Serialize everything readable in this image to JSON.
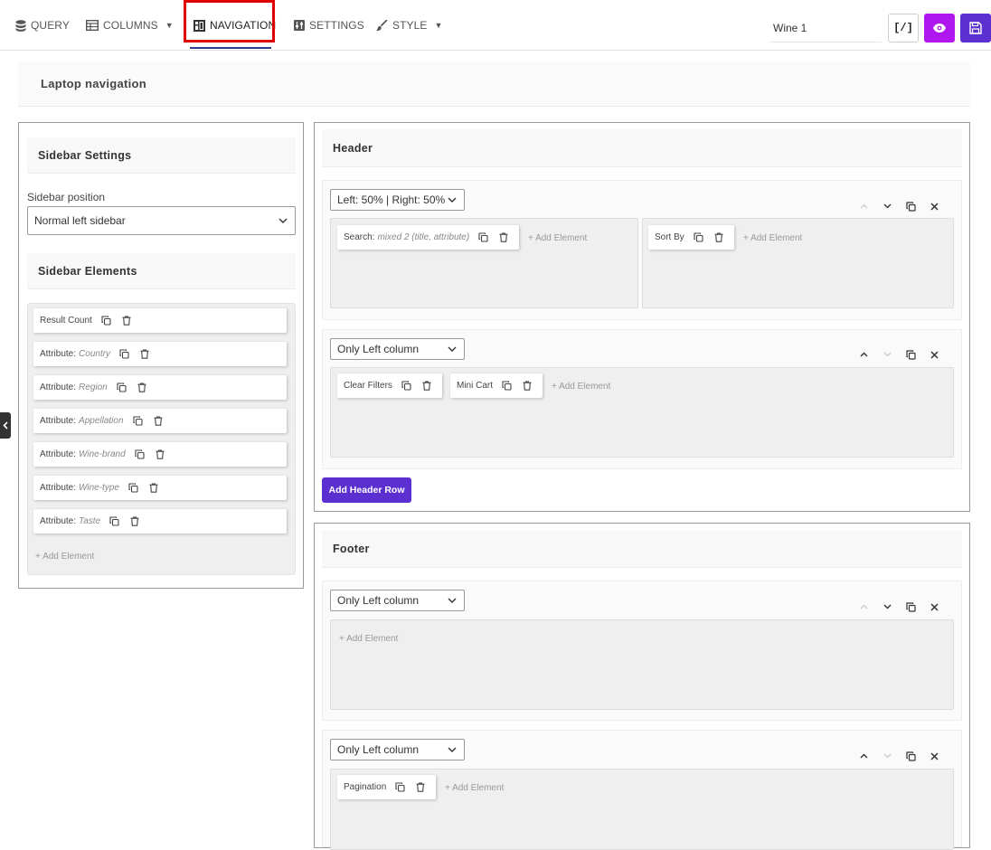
{
  "tabs": [
    {
      "label": "QUERY",
      "icon": "database-icon"
    },
    {
      "label": "COLUMNS",
      "icon": "table-icon"
    },
    {
      "label": "NAVIGATION",
      "icon": "layout-icon"
    },
    {
      "label": "SETTINGS",
      "icon": "settings-icon"
    },
    {
      "label": "STYLE",
      "icon": "brush-icon"
    }
  ],
  "active_tab": "NAVIGATION",
  "toolbar": {
    "table_name": "Wine 1",
    "code_label": "[/]"
  },
  "colors": {
    "preview": "#b017ee",
    "primary": "#5b2fd0",
    "highlight": "#e00000"
  },
  "laptop_title": "Laptop navigation",
  "sidebar": {
    "settings_title": "Sidebar Settings",
    "position_label": "Sidebar position",
    "position_value": "Normal left sidebar",
    "elements_title": "Sidebar Elements",
    "elements": [
      {
        "label": "Result Count",
        "sub": ""
      },
      {
        "label": "Attribute:",
        "sub": "Country"
      },
      {
        "label": "Attribute:",
        "sub": "Region"
      },
      {
        "label": "Attribute:",
        "sub": "Appellation"
      },
      {
        "label": "Attribute:",
        "sub": "Wine-brand"
      },
      {
        "label": "Attribute:",
        "sub": "Wine-type"
      },
      {
        "label": "Attribute:",
        "sub": "Taste"
      }
    ],
    "add_element": "+ Add Element"
  },
  "header": {
    "title": "Header",
    "rows": [
      {
        "layout": "Left: 50% | Right: 50%",
        "left_elements": [
          {
            "label": "Search:",
            "sub": "mixed 2 (title, attribute)"
          }
        ],
        "right_elements": [
          {
            "label": "Sort By",
            "sub": ""
          }
        ]
      },
      {
        "layout": "Only Left column",
        "left_elements": [
          {
            "label": "Clear Filters",
            "sub": ""
          },
          {
            "label": "Mini Cart",
            "sub": ""
          }
        ]
      }
    ],
    "add_row": "Add Header Row"
  },
  "footer": {
    "title": "Footer",
    "rows": [
      {
        "layout": "Only Left column",
        "left_elements": []
      },
      {
        "layout": "Only Left column",
        "left_elements": [
          {
            "label": "Pagination",
            "sub": ""
          }
        ]
      }
    ]
  },
  "add_element": "+ Add Element"
}
